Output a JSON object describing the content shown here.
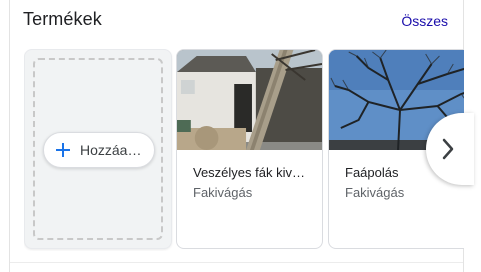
{
  "header": {
    "title": "Termékek",
    "see_all": "Összes"
  },
  "add_card": {
    "label": "Hozzáa…",
    "icon": "plus-icon"
  },
  "products": [
    {
      "name": "Veszélyes fák kiv…",
      "category": "Fakivágás"
    },
    {
      "name": "Faápolás",
      "category": "Fakivágás"
    }
  ],
  "nav": {
    "next_icon": "chevron-right-icon"
  },
  "colors": {
    "link": "#1a0dab",
    "accent": "#1a73e8"
  }
}
